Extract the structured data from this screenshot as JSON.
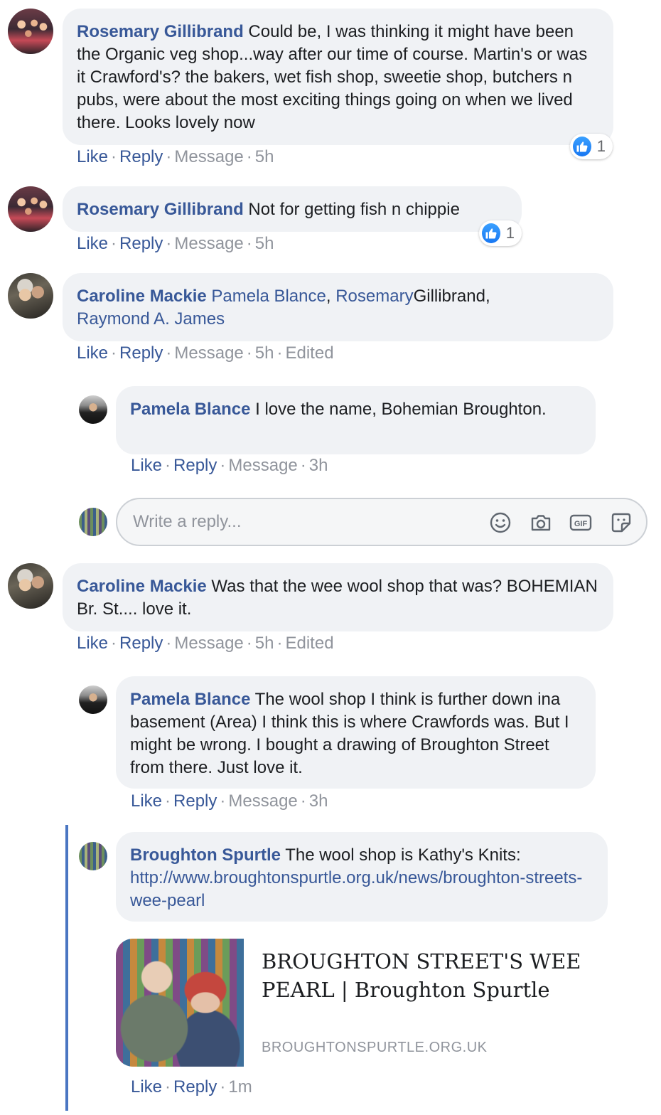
{
  "comments": [
    {
      "author": "Rosemary Gillibrand",
      "text": "Could be, I was thinking it might have been the Organic veg shop...way after our time of course. Martin's or was it Crawford's? the bakers, wet fish shop, sweetie shop, butchers n pubs, were about the most exciting things going on when we lived there. Looks lovely now",
      "actions": {
        "like": "Like",
        "reply": "Reply",
        "message": "Message",
        "time": "5h"
      },
      "reactions": "1"
    },
    {
      "author": "Rosemary Gillibrand",
      "text": "Not for getting fish n chippie",
      "actions": {
        "like": "Like",
        "reply": "Reply",
        "message": "Message",
        "time": "5h"
      },
      "reactions": "1"
    },
    {
      "author": "Caroline Mackie",
      "mention1": "Pamela Blance",
      "comma1": ", ",
      "mention2": "Rosemary",
      "plain2": "Gillibrand,",
      "mention3": "Raymond A. James",
      "actions": {
        "like": "Like",
        "reply": "Reply",
        "message": "Message",
        "time": "5h",
        "edited": "Edited"
      }
    },
    {
      "author": "Caroline Mackie",
      "text": "Was that the wee wool shop that was? BOHEMIAN Br. St.... love it.",
      "actions": {
        "like": "Like",
        "reply": "Reply",
        "message": "Message",
        "time": "5h",
        "edited": "Edited"
      }
    }
  ],
  "replies": [
    {
      "author": "Pamela Blance",
      "text": "I love the name, Bohemian Broughton.",
      "actions": {
        "like": "Like",
        "reply": "Reply",
        "message": "Message",
        "time": "3h"
      }
    },
    {
      "author": "Pamela Blance",
      "text": "The wool shop I think is further down ina basement (Area) I think this is where Crawfords was. But I might be wrong. I bought a drawing of Broughton Street from there. Just love it.",
      "actions": {
        "like": "Like",
        "reply": "Reply",
        "message": "Message",
        "time": "3h"
      }
    },
    {
      "author": "Broughton Spurtle",
      "text": "The wool shop is Kathy's Knits:",
      "link": "http://www.broughtonspurtle.org.uk/news/broughton-streets-wee-pearl",
      "actions": {
        "like": "Like",
        "reply": "Reply",
        "time": "1m"
      }
    }
  ],
  "reply_box": {
    "placeholder": "Write a reply...",
    "icons": [
      "emoji-icon",
      "camera-icon",
      "gif-icon",
      "sticker-icon"
    ],
    "gif_label": "GIF"
  },
  "link_preview": {
    "title": "BROUGHTON STREET'S WEE PEARL | Broughton Spurtle",
    "domain": "BROUGHTONSPURTLE.ORG.UK"
  },
  "colors": {
    "name": "#385898",
    "bubble": "#f0f2f5",
    "meta": "#90949c",
    "thread": "#4a76c2",
    "like": "#1877f2"
  }
}
